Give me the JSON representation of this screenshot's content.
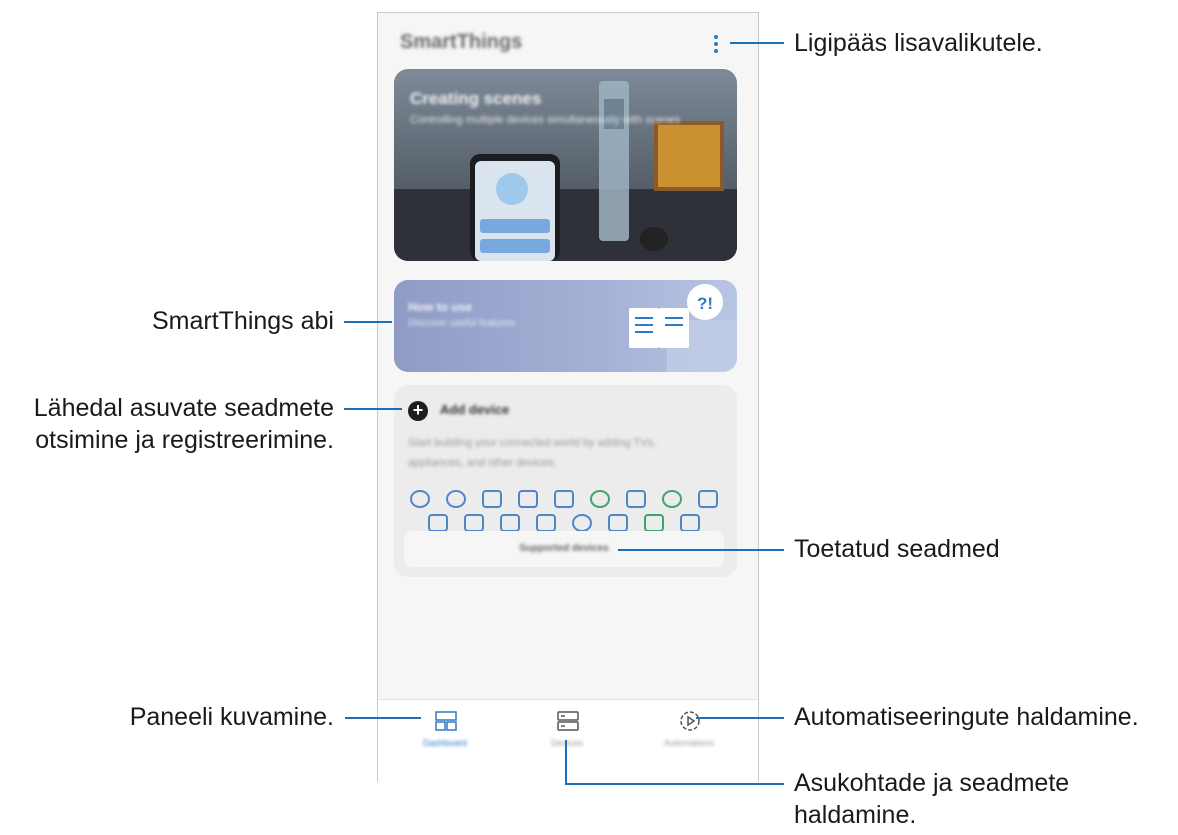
{
  "app": {
    "title": "SmartThings"
  },
  "cards": {
    "scenes": {
      "title": "Creating scenes",
      "subtitle": "Controlling multiple devices simultaneously with scenes"
    },
    "howto": {
      "title": "How to use",
      "subtitle": "Discover useful features"
    },
    "add_device": {
      "label": "Add device",
      "description": "Start building your connected world by adding TVs, appliances, and other devices.",
      "supported_button": "Supported devices"
    }
  },
  "bottom_nav": {
    "dashboard": "Dashboard",
    "devices": "Devices",
    "automations": "Automations",
    "active": "dashboard"
  },
  "callouts": {
    "more_options": "Ligipääs lisavalikutele.",
    "help": "SmartThings abi",
    "nearby_line1": "Lähedal asuvate seadmete",
    "nearby_line2": "otsimine ja registreerimine.",
    "supported": "Toetatud seadmed",
    "dashboard": "Paneeli kuvamine.",
    "automations": "Automatiseeringute haldamine.",
    "locations_line1": "Asukohtade ja seadmete",
    "locations_line2": "haldamine."
  },
  "colors": {
    "leader": "#1d70b8",
    "accent": "#2f7ac4"
  }
}
